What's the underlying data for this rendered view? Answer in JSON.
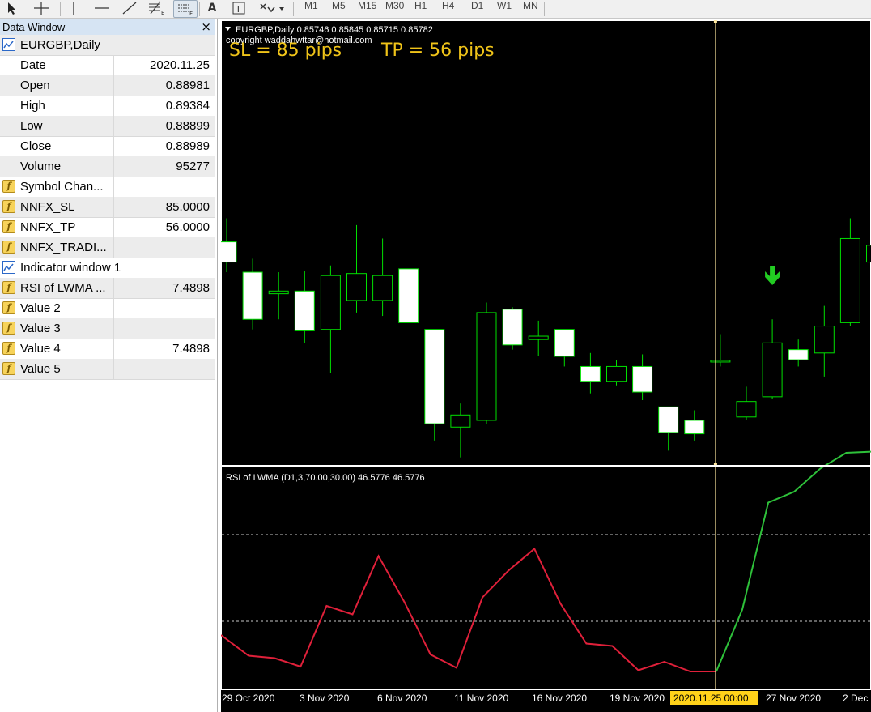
{
  "toolbar": {
    "tools": [
      "cursor-tool",
      "crosshair-tool",
      "vertical-line-tool",
      "horizontal-line-tool",
      "trendline-tool",
      "fibonacci-tool",
      "channel-tool",
      "text-tool",
      "text-label-tool",
      "arrows-tool"
    ],
    "text_tool": "A",
    "timeframes": [
      "M1",
      "M5",
      "M15",
      "M30",
      "H1",
      "H4",
      "D1",
      "W1",
      "MN"
    ],
    "active_timeframe": "D1"
  },
  "data_window": {
    "title": "Data Window",
    "close_glyph": "×",
    "rows": [
      {
        "label": "EURGBP,Daily",
        "value": "",
        "icon": "chart-icon"
      },
      {
        "label": "Date",
        "value": "2020.11.25",
        "icon": ""
      },
      {
        "label": "Open",
        "value": "0.88981",
        "icon": ""
      },
      {
        "label": "High",
        "value": "0.89384",
        "icon": ""
      },
      {
        "label": "Low",
        "value": "0.88899",
        "icon": ""
      },
      {
        "label": "Close",
        "value": "0.88989",
        "icon": ""
      },
      {
        "label": "Volume",
        "value": "95277",
        "icon": ""
      },
      {
        "label": "Symbol Chan...",
        "value": "",
        "icon": "indicator-icon"
      },
      {
        "label": "NNFX_SL",
        "value": "85.0000",
        "icon": "indicator-icon"
      },
      {
        "label": "NNFX_TP",
        "value": "56.0000",
        "icon": "indicator-icon"
      },
      {
        "label": "NNFX_TRADI...",
        "value": "",
        "icon": "indicator-icon"
      },
      {
        "label": "Indicator window 1",
        "value": "",
        "icon": "chart-icon"
      },
      {
        "label": "RSI of LWMA ...",
        "value": "7.4898",
        "icon": "indicator-icon"
      },
      {
        "label": "Value 2",
        "value": "",
        "icon": "indicator-icon"
      },
      {
        "label": "Value 3",
        "value": "",
        "icon": "indicator-icon"
      },
      {
        "label": "Value 4",
        "value": "7.4898",
        "icon": "indicator-icon"
      },
      {
        "label": "Value 5",
        "value": "",
        "icon": "indicator-icon"
      }
    ]
  },
  "chart": {
    "header": "EURGBP,Daily  0.85746 0.85845 0.85715 0.85782",
    "copyright": "copyright waddahwttar@hotmail.com",
    "sl_text": "SL = 85 pips",
    "tp_text": "TP = 56 pips",
    "indicator_header": "RSI of LWMA (D1,3,70.00,30.00) 46.5776 46.5776",
    "date_labels": [
      "29 Oct 2020",
      "3 Nov 2020",
      "6 Nov 2020",
      "11 Nov 2020",
      "16 Nov 2020",
      "19 Nov 2020",
      "27 Nov 2020",
      "2 Dec"
    ],
    "cursor_date_label": "2020.11.25 00:00",
    "colors": {
      "background": "#000000",
      "candle_outline": "#00e000",
      "candle_bull_fill": "#000000",
      "candle_bear_fill": "#ffffff",
      "sl_tp_text": "#f0c419",
      "rsi_down": "#e0203a",
      "rsi_up": "#2ec13a",
      "cursor_line": "#ffe8a0",
      "cursor_label_bg": "#ffd21a",
      "signal_arrow": "#22cc22"
    }
  },
  "chart_data": {
    "type": "candlestick",
    "symbol": "EURGBP",
    "timeframe": "Daily",
    "candles": [
      {
        "o": 0.9075,
        "h": 0.911,
        "l": 0.903,
        "c": 0.9045
      },
      {
        "o": 0.903,
        "h": 0.905,
        "l": 0.8945,
        "c": 0.896
      },
      {
        "o": 0.8998,
        "h": 0.903,
        "l": 0.896,
        "c": 0.9002
      },
      {
        "o": 0.9002,
        "h": 0.9032,
        "l": 0.8925,
        "c": 0.8943
      },
      {
        "o": 0.8945,
        "h": 0.904,
        "l": 0.888,
        "c": 0.9025
      },
      {
        "o": 0.8988,
        "h": 0.91,
        "l": 0.897,
        "c": 0.9028
      },
      {
        "o": 0.8988,
        "h": 0.908,
        "l": 0.8965,
        "c": 0.9025
      },
      {
        "o": 0.9035,
        "h": 0.9035,
        "l": 0.8955,
        "c": 0.8955
      },
      {
        "o": 0.8945,
        "h": 0.8945,
        "l": 0.878,
        "c": 0.8805
      },
      {
        "o": 0.88,
        "h": 0.8835,
        "l": 0.8755,
        "c": 0.8818
      },
      {
        "o": 0.881,
        "h": 0.8985,
        "l": 0.8805,
        "c": 0.897
      },
      {
        "o": 0.8975,
        "h": 0.8978,
        "l": 0.8915,
        "c": 0.8922
      },
      {
        "o": 0.893,
        "h": 0.8958,
        "l": 0.8905,
        "c": 0.8935
      },
      {
        "o": 0.8945,
        "h": 0.8945,
        "l": 0.889,
        "c": 0.8905
      },
      {
        "o": 0.889,
        "h": 0.891,
        "l": 0.885,
        "c": 0.8868
      },
      {
        "o": 0.8868,
        "h": 0.89,
        "l": 0.8862,
        "c": 0.889
      },
      {
        "o": 0.889,
        "h": 0.8908,
        "l": 0.884,
        "c": 0.8852
      },
      {
        "o": 0.883,
        "h": 0.883,
        "l": 0.8765,
        "c": 0.8792
      },
      {
        "o": 0.881,
        "h": 0.8825,
        "l": 0.878,
        "c": 0.879
      },
      {
        "o": 0.8898,
        "h": 0.8938,
        "l": 0.889,
        "c": 0.8899
      },
      {
        "o": 0.8815,
        "h": 0.886,
        "l": 0.881,
        "c": 0.8838
      },
      {
        "o": 0.8845,
        "h": 0.896,
        "l": 0.8842,
        "c": 0.8925
      },
      {
        "o": 0.8915,
        "h": 0.893,
        "l": 0.889,
        "c": 0.89
      },
      {
        "o": 0.891,
        "h": 0.898,
        "l": 0.8875,
        "c": 0.895
      },
      {
        "o": 0.8955,
        "h": 0.911,
        "l": 0.895,
        "c": 0.908
      },
      {
        "o": 0.9045,
        "h": 0.91,
        "l": 0.9025,
        "c": 0.907
      }
    ],
    "rsi": {
      "name": "RSI of LWMA",
      "values": [
        30,
        13,
        11,
        4,
        54,
        47,
        95,
        57,
        14,
        3,
        61,
        83,
        101,
        56,
        23,
        21,
        1,
        8,
        0,
        0,
        51,
        139,
        148,
        167,
        180,
        181
      ],
      "levels": [
        70,
        30
      ]
    },
    "selected_index": 19,
    "signal_arrow_index": 21
  }
}
